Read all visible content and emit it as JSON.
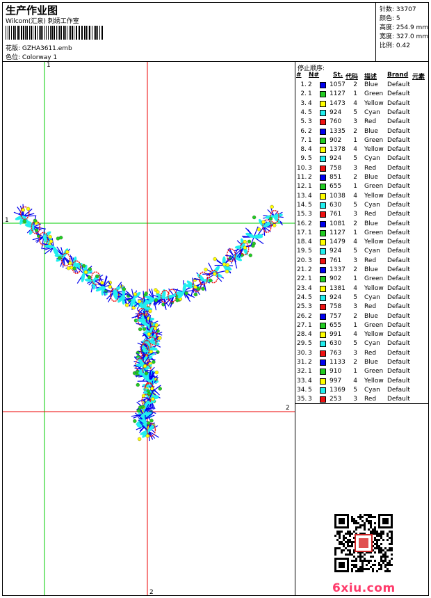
{
  "header": {
    "title": "生产作业图",
    "studio": "Wilcom(汇泉) 刺绣工作室",
    "design_label": "花版:",
    "design_file": "GZHA3611.emb",
    "colorway_label": "色位:",
    "colorway": "Colorway 1"
  },
  "stats": [
    {
      "label": "针数:",
      "value": "33707"
    },
    {
      "label": "颜色:",
      "value": "5"
    },
    {
      "label": "高度:",
      "value": "254.9 mm"
    },
    {
      "label": "宽度:",
      "value": "327.0 mm"
    },
    {
      "label": "比例:",
      "value": "0.42"
    }
  ],
  "stop_sequence": {
    "title": "停止顺序:",
    "headers": {
      "num": "#",
      "needle": "N#",
      "stitches": "St.",
      "code": "代码",
      "desc": "描述",
      "brand": "Brand",
      "element": "元素"
    },
    "colors": {
      "1": "#22cc22",
      "2": "#0000ee",
      "3": "#ee1111",
      "4": "#ffff00",
      "5": "#22eeee"
    },
    "rows": [
      {
        "num": "1.",
        "needle": "2",
        "stitches": "1057",
        "code": "2",
        "desc": "Blue",
        "brand": "Default"
      },
      {
        "num": "2.",
        "needle": "1",
        "stitches": "1127",
        "code": "1",
        "desc": "Green",
        "brand": "Default"
      },
      {
        "num": "3.",
        "needle": "4",
        "stitches": "1473",
        "code": "4",
        "desc": "Yellow",
        "brand": "Default"
      },
      {
        "num": "4.",
        "needle": "5",
        "stitches": "924",
        "code": "5",
        "desc": "Cyan",
        "brand": "Default"
      },
      {
        "num": "5.",
        "needle": "3",
        "stitches": "760",
        "code": "3",
        "desc": "Red",
        "brand": "Default"
      },
      {
        "num": "6.",
        "needle": "2",
        "stitches": "1335",
        "code": "2",
        "desc": "Blue",
        "brand": "Default"
      },
      {
        "num": "7.",
        "needle": "1",
        "stitches": "902",
        "code": "1",
        "desc": "Green",
        "brand": "Default"
      },
      {
        "num": "8.",
        "needle": "4",
        "stitches": "1378",
        "code": "4",
        "desc": "Yellow",
        "brand": "Default"
      },
      {
        "num": "9.",
        "needle": "5",
        "stitches": "924",
        "code": "5",
        "desc": "Cyan",
        "brand": "Default"
      },
      {
        "num": "10.",
        "needle": "3",
        "stitches": "758",
        "code": "3",
        "desc": "Red",
        "brand": "Default"
      },
      {
        "num": "11.",
        "needle": "2",
        "stitches": "851",
        "code": "2",
        "desc": "Blue",
        "brand": "Default"
      },
      {
        "num": "12.",
        "needle": "1",
        "stitches": "655",
        "code": "1",
        "desc": "Green",
        "brand": "Default"
      },
      {
        "num": "13.",
        "needle": "4",
        "stitches": "1038",
        "code": "4",
        "desc": "Yellow",
        "brand": "Default"
      },
      {
        "num": "14.",
        "needle": "5",
        "stitches": "630",
        "code": "5",
        "desc": "Cyan",
        "brand": "Default"
      },
      {
        "num": "15.",
        "needle": "3",
        "stitches": "761",
        "code": "3",
        "desc": "Red",
        "brand": "Default"
      },
      {
        "num": "16.",
        "needle": "2",
        "stitches": "1081",
        "code": "2",
        "desc": "Blue",
        "brand": "Default"
      },
      {
        "num": "17.",
        "needle": "1",
        "stitches": "1127",
        "code": "1",
        "desc": "Green",
        "brand": "Default"
      },
      {
        "num": "18.",
        "needle": "4",
        "stitches": "1479",
        "code": "4",
        "desc": "Yellow",
        "brand": "Default"
      },
      {
        "num": "19.",
        "needle": "5",
        "stitches": "924",
        "code": "5",
        "desc": "Cyan",
        "brand": "Default"
      },
      {
        "num": "20.",
        "needle": "3",
        "stitches": "761",
        "code": "3",
        "desc": "Red",
        "brand": "Default"
      },
      {
        "num": "21.",
        "needle": "2",
        "stitches": "1337",
        "code": "2",
        "desc": "Blue",
        "brand": "Default"
      },
      {
        "num": "22.",
        "needle": "1",
        "stitches": "902",
        "code": "1",
        "desc": "Green",
        "brand": "Default"
      },
      {
        "num": "23.",
        "needle": "4",
        "stitches": "1381",
        "code": "4",
        "desc": "Yellow",
        "brand": "Default"
      },
      {
        "num": "24.",
        "needle": "5",
        "stitches": "924",
        "code": "5",
        "desc": "Cyan",
        "brand": "Default"
      },
      {
        "num": "25.",
        "needle": "3",
        "stitches": "758",
        "code": "3",
        "desc": "Red",
        "brand": "Default"
      },
      {
        "num": "26.",
        "needle": "2",
        "stitches": "757",
        "code": "2",
        "desc": "Blue",
        "brand": "Default"
      },
      {
        "num": "27.",
        "needle": "1",
        "stitches": "655",
        "code": "1",
        "desc": "Green",
        "brand": "Default"
      },
      {
        "num": "28.",
        "needle": "4",
        "stitches": "991",
        "code": "4",
        "desc": "Yellow",
        "brand": "Default"
      },
      {
        "num": "29.",
        "needle": "5",
        "stitches": "630",
        "code": "5",
        "desc": "Cyan",
        "brand": "Default"
      },
      {
        "num": "30.",
        "needle": "3",
        "stitches": "763",
        "code": "3",
        "desc": "Red",
        "brand": "Default"
      },
      {
        "num": "31.",
        "needle": "2",
        "stitches": "1133",
        "code": "2",
        "desc": "Blue",
        "brand": "Default"
      },
      {
        "num": "32.",
        "needle": "1",
        "stitches": "910",
        "code": "1",
        "desc": "Green",
        "brand": "Default"
      },
      {
        "num": "33.",
        "needle": "4",
        "stitches": "997",
        "code": "4",
        "desc": "Yellow",
        "brand": "Default"
      },
      {
        "num": "34.",
        "needle": "5",
        "stitches": "1369",
        "code": "5",
        "desc": "Cyan",
        "brand": "Default"
      },
      {
        "num": "35.",
        "needle": "3",
        "stitches": "253",
        "code": "3",
        "desc": "Red",
        "brand": "Default"
      }
    ]
  },
  "crosshair_labels": {
    "v1": "1",
    "h1": "1",
    "h2": "2",
    "v2": "2"
  },
  "watermark": "6xiu.com"
}
